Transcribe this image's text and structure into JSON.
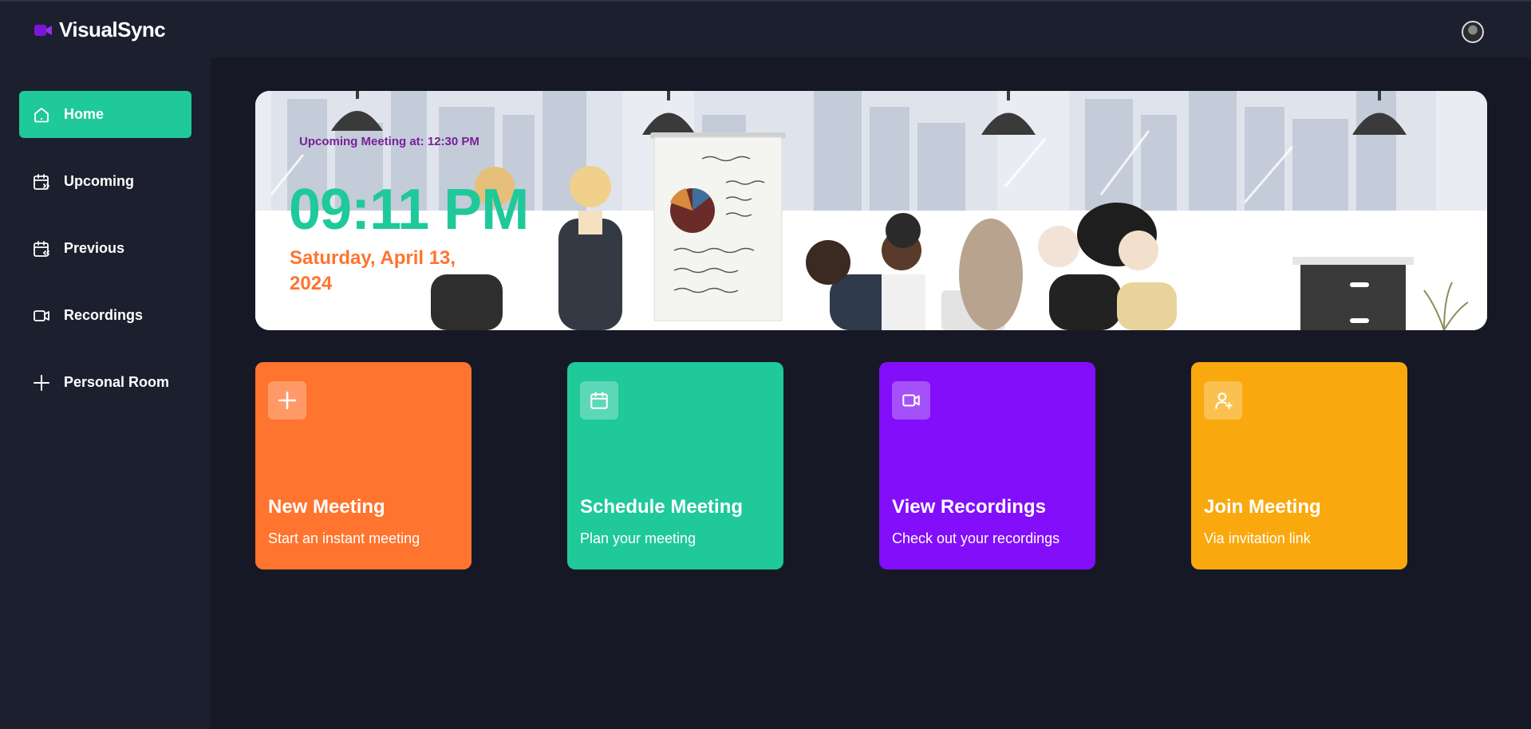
{
  "app": {
    "name": "VisualSync"
  },
  "sidebar": {
    "items": [
      {
        "label": "Home",
        "icon": "home-icon",
        "active": true
      },
      {
        "label": "Upcoming",
        "icon": "calendar-forward-icon",
        "active": false
      },
      {
        "label": "Previous",
        "icon": "calendar-back-icon",
        "active": false
      },
      {
        "label": "Recordings",
        "icon": "video-icon",
        "active": false
      },
      {
        "label": "Personal Room",
        "icon": "plus-icon",
        "active": false
      }
    ]
  },
  "banner": {
    "upcoming": "Upcoming Meeting at: 12:30 PM",
    "time": "09:11 PM",
    "date": "Saturday, April 13, 2024"
  },
  "cards": [
    {
      "title": "New Meeting",
      "subtitle": "Start an instant meeting",
      "icon": "plus-icon",
      "color": "#ff742e"
    },
    {
      "title": "Schedule Meeting",
      "subtitle": "Plan your meeting",
      "icon": "calendar-icon",
      "color": "#1fc99a"
    },
    {
      "title": "View Recordings",
      "subtitle": "Check out your recordings",
      "icon": "video-icon",
      "color": "#830ef9"
    },
    {
      "title": "Join Meeting",
      "subtitle": "Via invitation link",
      "icon": "user-plus-icon",
      "color": "#f9a90e"
    }
  ],
  "colors": {
    "accent": "#1fc99a",
    "orange": "#ff742e",
    "purple": "#830ef9",
    "yellow": "#f9a90e",
    "upcoming_text": "#7a1f9a",
    "background": "#161925",
    "panel": "#1c1f2e"
  }
}
